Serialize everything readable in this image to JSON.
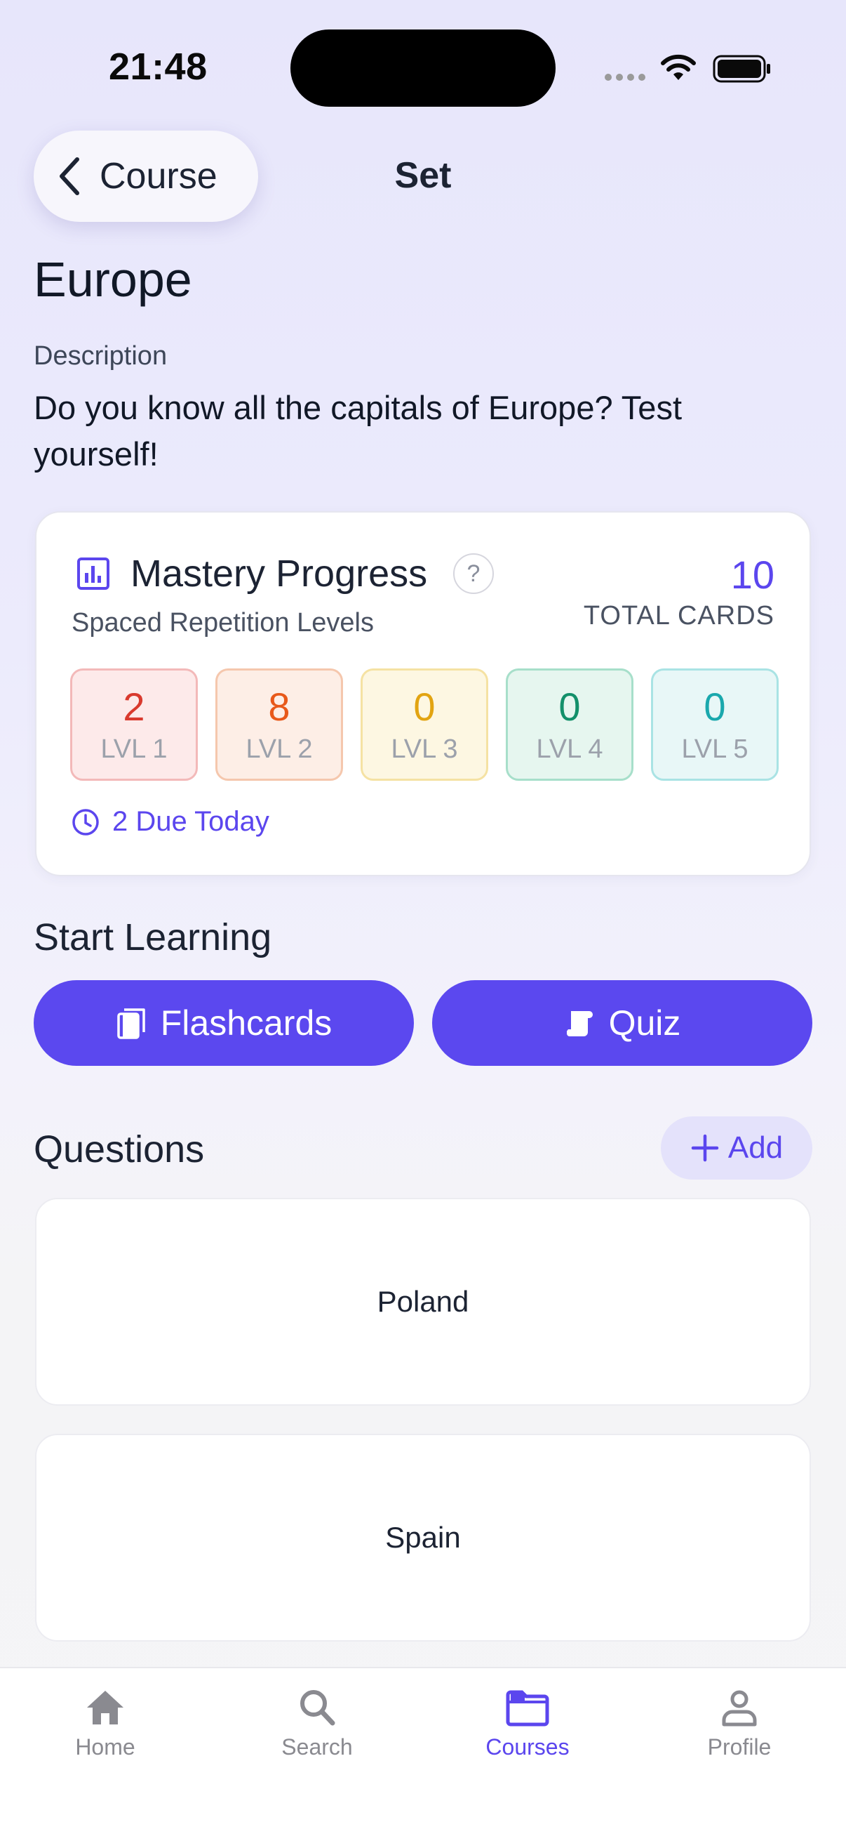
{
  "status_bar": {
    "time": "21:48"
  },
  "nav": {
    "back_label": "Course",
    "title": "Set"
  },
  "set": {
    "title": "Europe",
    "description_label": "Description",
    "description": "Do you know all the capitals of Europe? Test yourself!"
  },
  "mastery": {
    "title": "Mastery Progress",
    "help_glyph": "?",
    "subtitle": "Spaced Repetition Levels",
    "total_count": "10",
    "total_label": "TOTAL CARDS",
    "levels": [
      {
        "count": "2",
        "label": "LVL 1",
        "color": "#d93a2e",
        "bg": "#fdeaea",
        "border": "#f3b9b9"
      },
      {
        "count": "8",
        "label": "LVL 2",
        "color": "#e8591a",
        "bg": "#fdeee6",
        "border": "#f5c7ad"
      },
      {
        "count": "0",
        "label": "LVL 3",
        "color": "#e2a411",
        "bg": "#fdf7e2",
        "border": "#f5e2a3"
      },
      {
        "count": "0",
        "label": "LVL 4",
        "color": "#13906a",
        "bg": "#e6f6ef",
        "border": "#a7dfca"
      },
      {
        "count": "0",
        "label": "LVL 5",
        "color": "#1aa8ad",
        "bg": "#e8f7f7",
        "border": "#a9e3e4"
      }
    ],
    "due_label": "2 Due Today"
  },
  "start_learning": {
    "title": "Start Learning",
    "flashcards_label": "Flashcards",
    "quiz_label": "Quiz"
  },
  "questions": {
    "title": "Questions",
    "add_label": "Add",
    "items": [
      "Poland",
      "Spain"
    ]
  },
  "tab_bar": {
    "items": [
      {
        "label": "Home",
        "icon": "house-icon"
      },
      {
        "label": "Search",
        "icon": "magnifier-icon"
      },
      {
        "label": "Courses",
        "icon": "folder-icon",
        "active": true
      },
      {
        "label": "Profile",
        "icon": "person-icon"
      }
    ]
  },
  "colors": {
    "accent": "#5b46ee",
    "text": "#1c2333",
    "inactive_tab": "#8a8a90"
  }
}
